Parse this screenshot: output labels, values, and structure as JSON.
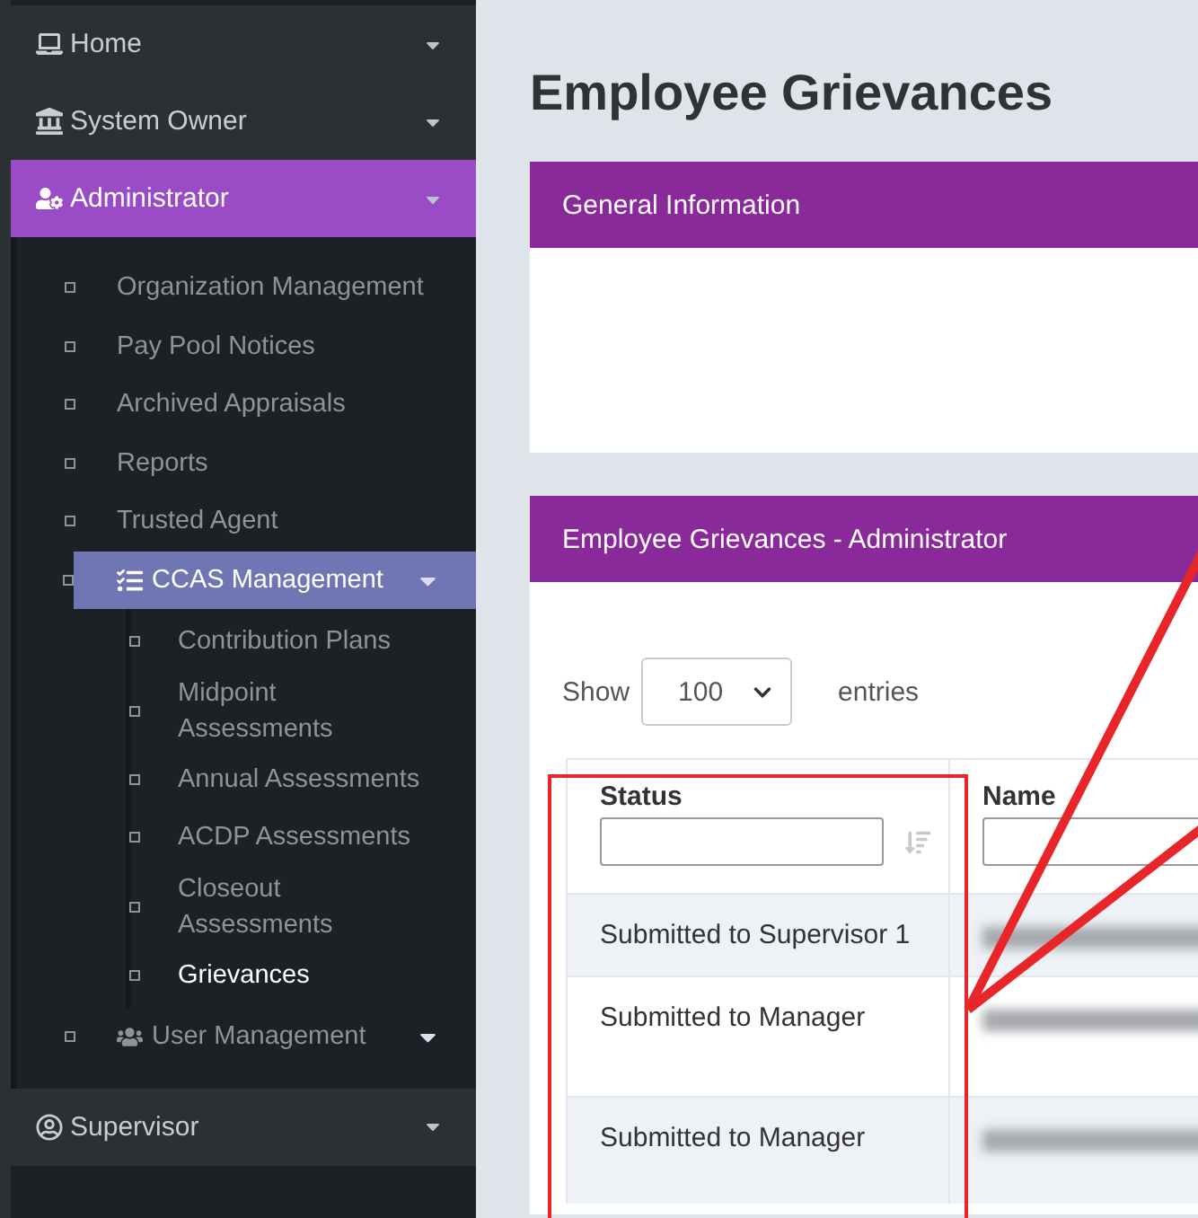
{
  "sidebar": {
    "items": [
      {
        "label": "Home",
        "kind": "menu",
        "selected": false
      },
      {
        "label": "System Owner",
        "kind": "menu",
        "selected": false
      },
      {
        "label": "Administrator",
        "kind": "menu",
        "selected": true,
        "expanded": true,
        "children": [
          {
            "label": "Organization Management",
            "kind": "link",
            "selected": false
          },
          {
            "label": "Pay Pool Notices",
            "kind": "link",
            "selected": false
          },
          {
            "label": "Archived Appraisals",
            "kind": "link",
            "selected": false
          },
          {
            "label": "Reports",
            "kind": "link",
            "selected": false
          },
          {
            "label": "Trusted Agent",
            "kind": "link",
            "selected": false
          },
          {
            "label": "CCAS Management",
            "kind": "menu",
            "selected": true,
            "expanded": true,
            "children": [
              {
                "label": "Contribution Plans",
                "selected": false
              },
              {
                "label": "Midpoint Assessments",
                "selected": false
              },
              {
                "label": "Annual Assessments",
                "selected": false
              },
              {
                "label": "ACDP Assessments",
                "selected": false
              },
              {
                "label": "Closeout Assessments",
                "selected": false
              },
              {
                "label": "Grievances",
                "selected": true
              }
            ]
          },
          {
            "label": "User Management",
            "kind": "menu",
            "selected": false
          }
        ]
      },
      {
        "label": "Supervisor",
        "kind": "menu",
        "selected": false
      }
    ]
  },
  "page_title": "Employee Grievances",
  "general_panel": {
    "title": "General Information"
  },
  "grievance_panel": {
    "title": "Employee Grievances - Administrator",
    "length": {
      "label_before": "Show",
      "value": "100",
      "label_after": "entries"
    },
    "table": {
      "columns": [
        {
          "label": "Status"
        },
        {
          "label": "Name"
        }
      ],
      "rows": [
        {
          "status": "Submitted to Supervisor 1"
        },
        {
          "status": "Submitted to Manager"
        },
        {
          "status": "Submitted to Manager"
        }
      ]
    }
  }
}
